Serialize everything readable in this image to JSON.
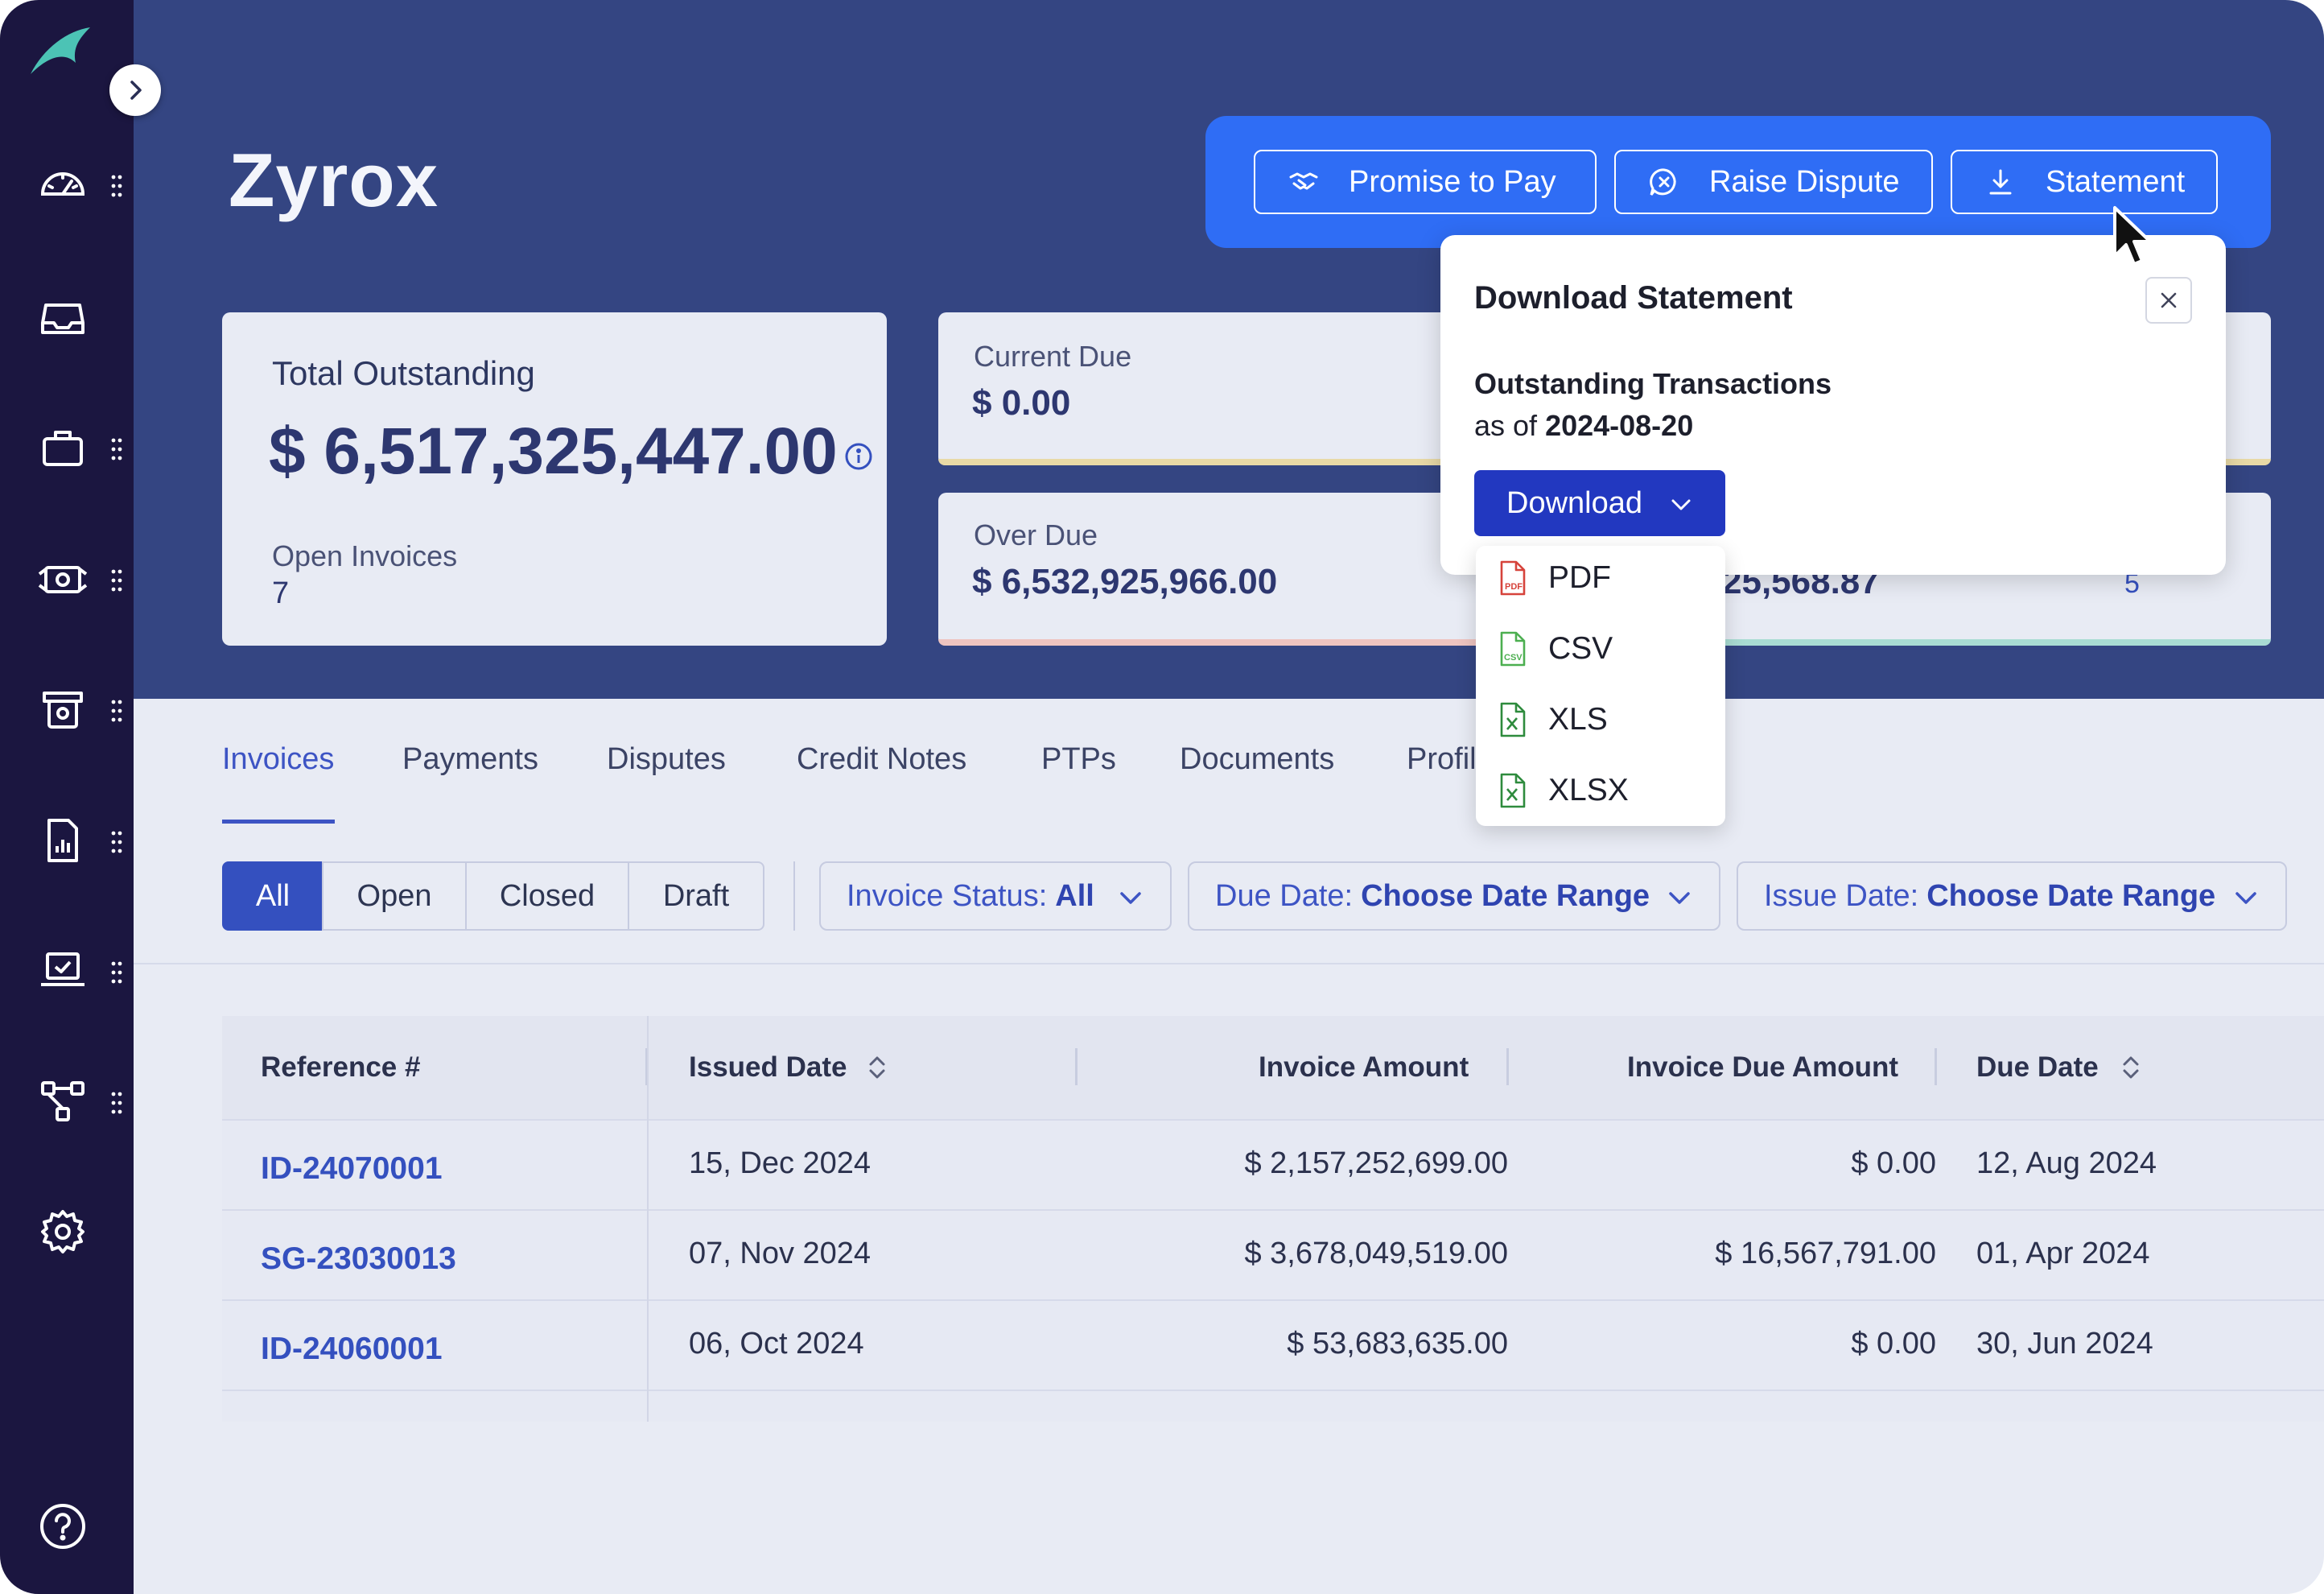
{
  "company": {
    "name": "Zyrox"
  },
  "actions": {
    "promise_to_pay": "Promise to Pay",
    "raise_dispute": "Raise Dispute",
    "statement": "Statement"
  },
  "summary": {
    "total_outstanding_label": "Total Outstanding",
    "total_outstanding_value": "$ 6,517,325,447.00",
    "open_invoices_label": "Open Invoices",
    "open_invoices_value": "7",
    "current_due_label": "Current Due",
    "current_due_value": "$ 0.00",
    "over_due_label": "Over Due",
    "over_due_value": "$ 6,532,925,966.00",
    "partial_amount_value": "25,568.87",
    "partial_count_value": "5",
    "colors": {
      "current_due_bar": "#e8d9a6",
      "over_due_bar": "#eec4c0",
      "third_bar": "#a9dcd3"
    }
  },
  "popover": {
    "title": "Download Statement",
    "subtitle": "Outstanding Transactions",
    "as_of_prefix": "as of",
    "as_of_date": "2024-08-20",
    "download_label": "Download",
    "formats": [
      "PDF",
      "CSV",
      "XLS",
      "XLSX"
    ]
  },
  "tabs": [
    {
      "label": "Invoices",
      "active": true
    },
    {
      "label": "Payments"
    },
    {
      "label": "Disputes"
    },
    {
      "label": "Credit Notes"
    },
    {
      "label": "PTPs"
    },
    {
      "label": "Documents"
    },
    {
      "label": "Profil"
    }
  ],
  "status_filters": [
    "All",
    "Open",
    "Closed",
    "Draft"
  ],
  "filters": {
    "invoice_status_label": "Invoice Status:",
    "invoice_status_value": "All",
    "due_date_label": "Due Date:",
    "due_date_value": "Choose Date Range",
    "issue_date_label": "Issue Date:",
    "issue_date_value": "Choose Date Range"
  },
  "table": {
    "headers": [
      "Reference #",
      "Issued Date",
      "Invoice Amount",
      "Invoice Due Amount",
      "Due Date"
    ],
    "rows": [
      {
        "ref": "ID-24070001",
        "issued": "15, Dec 2024",
        "amount": "$ 2,157,252,699.00",
        "due_amount": "$ 0.00",
        "due_date": "12, Aug 2024"
      },
      {
        "ref": "SG-23030013",
        "issued": "07, Nov 2024",
        "amount": "$ 3,678,049,519.00",
        "due_amount": "$ 16,567,791.00",
        "due_date": "01, Apr 2024"
      },
      {
        "ref": "ID-24060001",
        "issued": "06, Oct 2024",
        "amount": "$ 53,683,635.00",
        "due_amount": "$ 0.00",
        "due_date": "30, Jun 2024"
      }
    ]
  },
  "theme": {
    "header_bg": "#344582",
    "sidebar_bg": "#1b1640",
    "action_bar_bg": "#2f6df5",
    "accent": "#3450bf",
    "logo_color": "#4cc3b5"
  }
}
